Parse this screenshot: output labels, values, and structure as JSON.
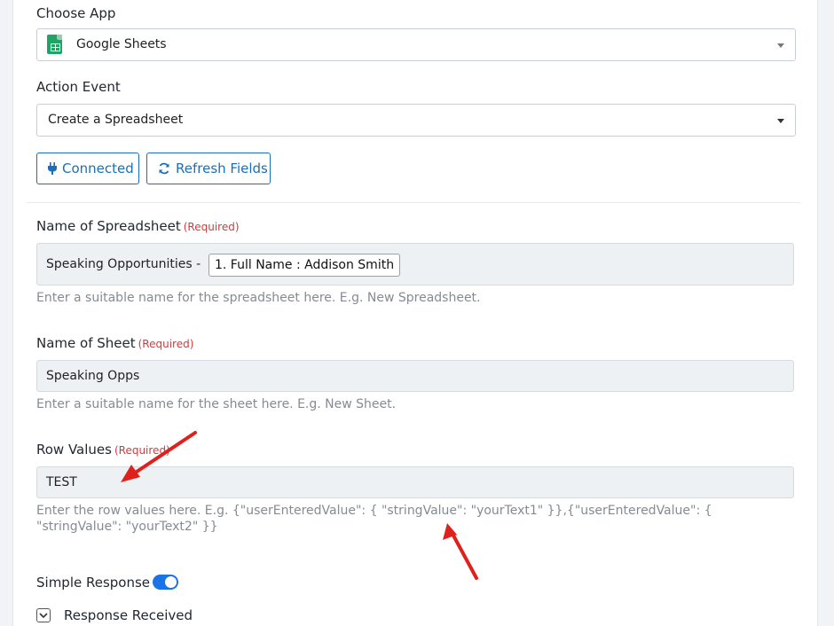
{
  "choose_app": {
    "label": "Choose App",
    "value": "Google Sheets",
    "icon": "google-sheets-icon"
  },
  "action_event": {
    "label": "Action Event",
    "value": "Create a Spreadsheet"
  },
  "buttons": {
    "connected": "Connected",
    "refresh": "Refresh Fields"
  },
  "spreadsheet_name": {
    "label": "Name of Spreadsheet",
    "required": "(Required)",
    "prefix": "Speaking Opportunities -",
    "token": "1. Full Name : Addison Smith",
    "help": "Enter a suitable name for the spreadsheet here. E.g. New Spreadsheet."
  },
  "sheet_name": {
    "label": "Name of Sheet",
    "required": "(Required)",
    "value": "Speaking Opps",
    "help": "Enter a suitable name for the sheet here. E.g. New Sheet."
  },
  "row_values": {
    "label": "Row Values",
    "required": "(Required)",
    "value": "TEST",
    "help": "Enter the row values here. E.g. {\"userEnteredValue\": { \"stringValue\": \"yourText1\" }},{\"userEnteredValue\": { \"stringValue\": \"yourText2\" }}"
  },
  "simple_response": {
    "label": "Simple Response",
    "enabled": true
  },
  "response_received": {
    "label": "Response Received"
  },
  "colors": {
    "primary": "#1b6fb8",
    "required": "#d23b3b",
    "toggle": "#1a73e8",
    "annotation": "#e0201b"
  }
}
